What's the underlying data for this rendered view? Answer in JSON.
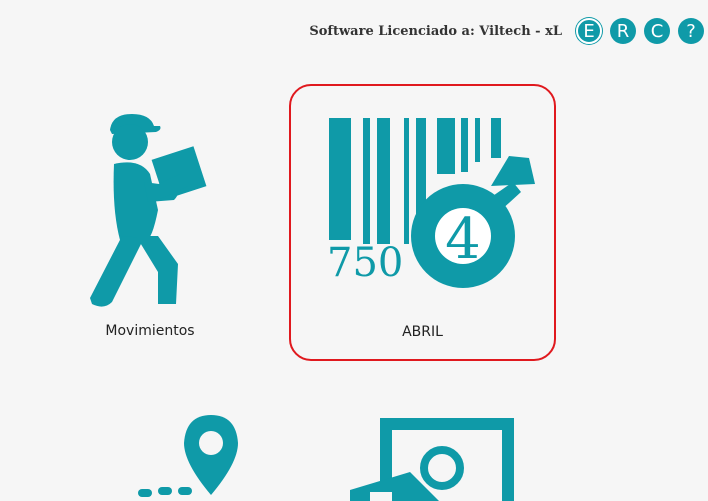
{
  "header": {
    "license_text": "Software Licenciado a: Viltech - xL",
    "buttons": [
      {
        "label": "E"
      },
      {
        "label": "R"
      },
      {
        "label": "C"
      },
      {
        "label": "?"
      }
    ]
  },
  "tiles": [
    {
      "label": "Movimientos",
      "icon": "delivery-man-icon"
    },
    {
      "label": "ABRIL",
      "icon": "barcode-search-icon",
      "selected": true,
      "barcode_number": "750",
      "lens_number": "4"
    },
    {
      "label": "",
      "icon": "route-pin-icon"
    },
    {
      "label": "",
      "icon": "product-photo-icon"
    }
  ],
  "colors": {
    "accent": "#0f9aa8",
    "selected_border": "#e0191e",
    "background": "#f6f6f6"
  }
}
